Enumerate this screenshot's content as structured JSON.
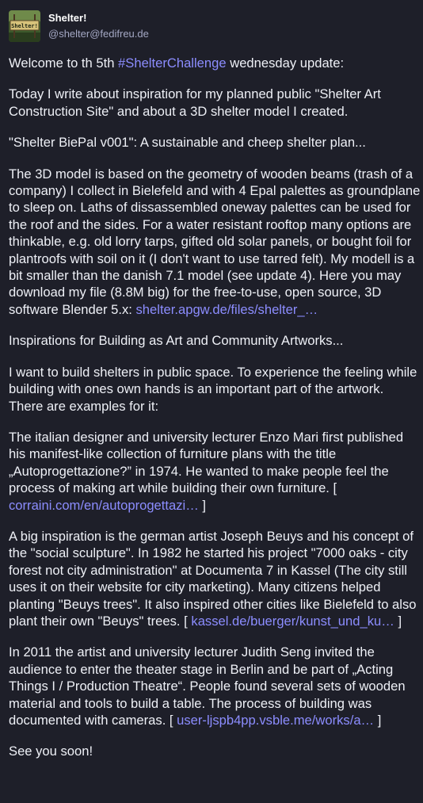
{
  "account": {
    "display_name": "Shelter!",
    "handle": "@shelter@fedifreu.de",
    "avatar_icon": "shelter-sign-avatar",
    "avatar_text": "Shelter!"
  },
  "colors": {
    "background": "#1e1f29",
    "text": "#eef0f6",
    "link": "#8c8dff",
    "muted": "#a4a8c4"
  },
  "post": {
    "p1": {
      "before": "Welcome to th 5th ",
      "hashtag": "#ShelterChallenge",
      "after": " wednesday update:"
    },
    "p2": "Today I write about inspiration for my planned public \"Shelter Art Construction Site\" and about a 3D shelter model I created.",
    "p3": "\"Shelter BiePal v001\": A sustainable and cheep shelter plan...",
    "p4": {
      "text": "The 3D model is based on the geometry of wooden beams (trash of a company) I collect in Bielefeld and with 4 Epal palettes as groundplane to sleep on. Laths of dissassembled oneway palettes can be used for the roof and the sides. For a water resistant rooftop many options are thinkable, e.g. old lorry tarps, gifted old solar panels, or bought foil for plantroofs with soil on it (I don't want to use tarred felt). My modell is a bit smaller than the danish 7.1 model (see update 4). Here you may download my file (8.8M big) for the free-to-use, open source, 3D software Blender 5.x: ",
      "link": "shelter.apgw.de/files/shelter_…"
    },
    "p5": "Inspirations for Building as Art and Community Artworks...",
    "p6": "I want to build shelters in public space. To experience the feeling while building with ones own hands is an important part of the artwork. There are examples for it:",
    "p7": {
      "text": "The italian designer and university lecturer Enzo Mari first published his manifest-like collection of furniture plans with the title „Autoprogettazione?” in 1974. He wanted to make people feel the process of making art while building their own furniture. [ ",
      "link": "corraini.com/en/autoprogettazi…",
      "after": " ]"
    },
    "p8": {
      "text": "A big inspiration is the german artist Joseph Beuys and his concept of the \"social sculpture\". In 1982 he started his project \"7000 oaks - city forest not city administration\" at Documenta 7 in Kassel (The city still uses it on their website for city marketing). Many citizens helped planting \"Beuys trees\". It also inspired other cities like Bielefeld to also plant their own \"Beuys\" trees. [ ",
      "link": "kassel.de/buerger/kunst_und_ku…",
      "after": " ]"
    },
    "p9": {
      "text": "In 2011 the artist and university lecturer Judith Seng invited the audience to enter the theater stage in Berlin and be part of „Acting Things I / Production Theatre“. People found several sets of wooden material and tools to build a table. The process of building was documented with cameras. [ ",
      "link": "user-ljspb4pp.vsble.me/works/a…",
      "after": " ]"
    },
    "p10": "See you soon!"
  }
}
